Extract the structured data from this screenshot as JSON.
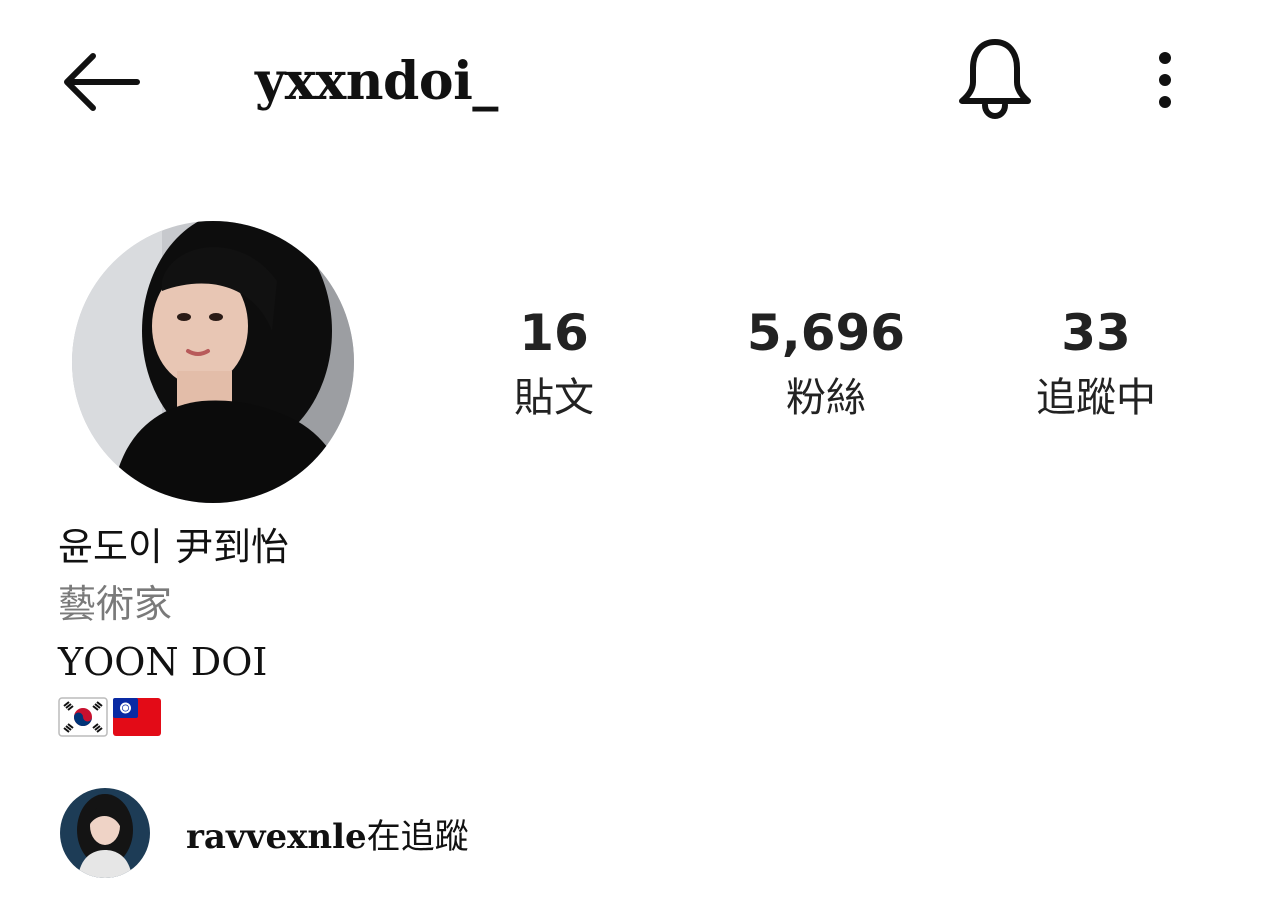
{
  "header": {
    "username": "yxxndoi_",
    "icons": {
      "back": "arrow-left-icon",
      "bell": "bell-icon",
      "more": "more-vertical-icon"
    }
  },
  "stats": [
    {
      "value": "16",
      "label": "貼文"
    },
    {
      "value": "5,696",
      "label": "粉絲"
    },
    {
      "value": "33",
      "label": "追蹤中"
    }
  ],
  "bio": {
    "name": "윤도이 尹到怡",
    "category": "藝術家",
    "text": "YOON DOI",
    "flags": [
      "south-korea-flag",
      "taiwan-flag"
    ]
  },
  "followed_by": {
    "username": "ravvexnle",
    "suffix": "在追蹤"
  },
  "colors": {
    "text": "#111111",
    "muted": "#7a7a7a",
    "background": "#ffffff"
  }
}
